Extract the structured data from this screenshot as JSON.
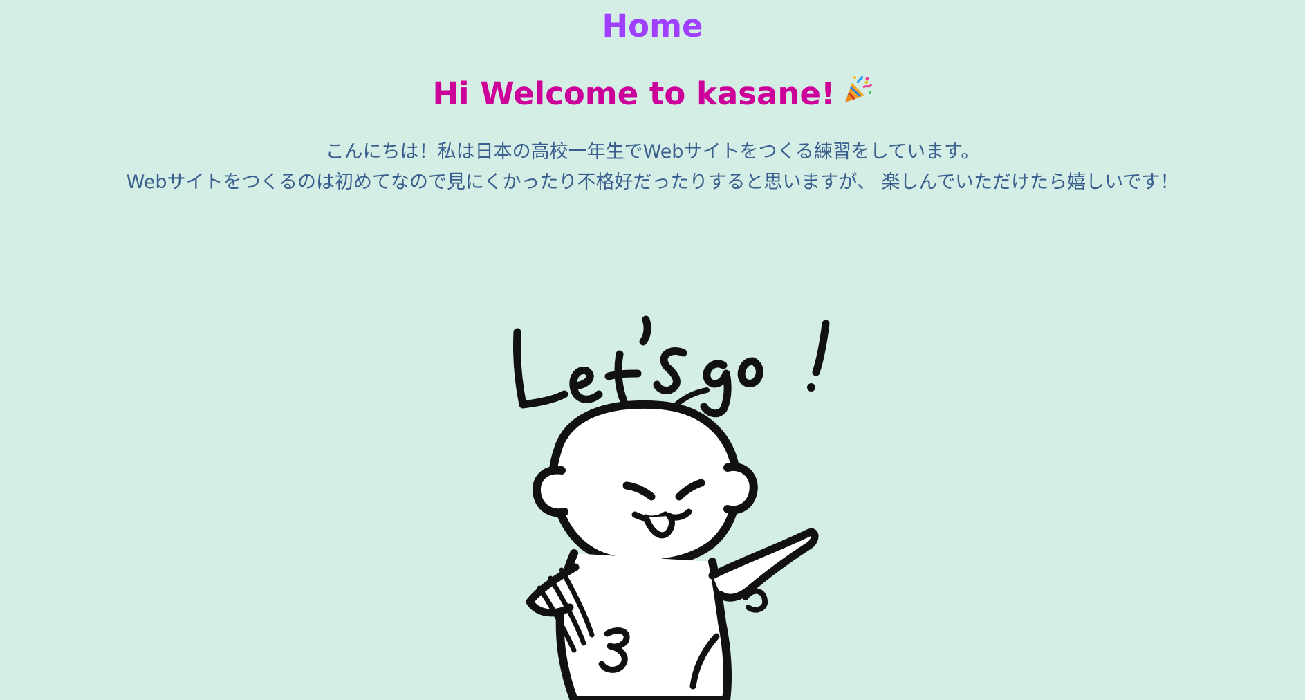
{
  "page": {
    "nav_title": "Home",
    "welcome_heading": "Hi Welcome to kasane!",
    "intro_lines": [
      "こんにちは！私は日本の高校一年生でWebサイトをつくる練習をしています。",
      "Webサイトをつくるのは初めてなので見にくかったり不格好だったりすると思いますが、 楽しんでいただけたら嬉しいです！"
    ],
    "illustration": {
      "icon": "lets-go-character-illustration",
      "lettering": "Let's go!"
    },
    "heading_icon": "party-popper-icon"
  },
  "colors": {
    "background": "#d4eee5",
    "nav_title": "#a040ff",
    "welcome_heading": "#cc0099",
    "intro_text": "#3a5f8f",
    "ink": "#111111"
  }
}
